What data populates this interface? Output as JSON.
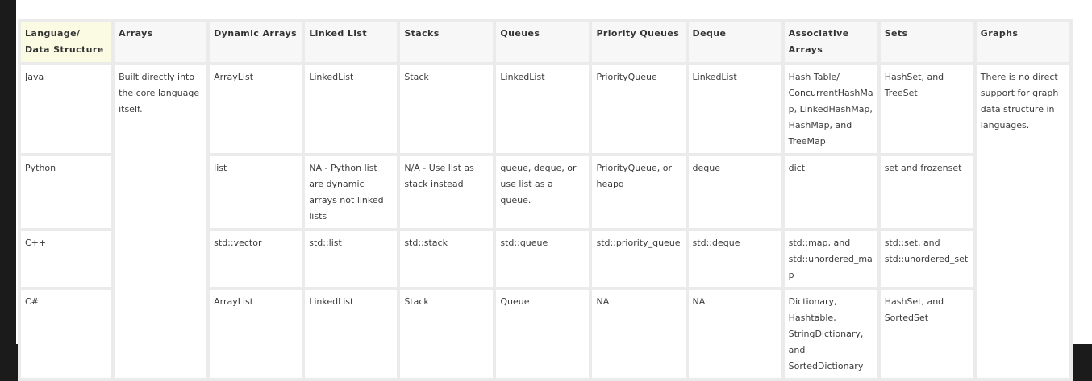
{
  "headers": [
    "Language/ Data Structure",
    "Arrays",
    "Dynamic Arrays",
    "Linked List",
    "Stacks",
    "Queues",
    "Priority Queues",
    "Deque",
    "Associative Arrays",
    "Sets",
    "Graphs"
  ],
  "arrays_note": "Built directly into the core language itself.",
  "graphs_note": "There is no direct support for graph data structure in languages.",
  "rows": [
    {
      "language": "Java",
      "dynamic_arrays": "ArrayList",
      "linked_list": "LinkedList",
      "stacks": "Stack",
      "queues": "LinkedList",
      "priority_queues": "PriorityQueue",
      "deque": "LinkedList",
      "associative_arrays": "Hash Table/ ConcurrentHashMap, LinkedHashMap, HashMap, and TreeMap",
      "sets": "HashSet, and TreeSet"
    },
    {
      "language": "Python",
      "dynamic_arrays": "list",
      "linked_list": "NA - Python list are dynamic arrays not linked lists",
      "stacks": "N/A - Use list as stack instead",
      "queues": "queue, deque, or use list as a queue.",
      "priority_queues": "PriorityQueue, or heapq",
      "deque": "deque",
      "associative_arrays": "dict",
      "sets": "set and frozenset"
    },
    {
      "language": "C++",
      "dynamic_arrays": "std::vector",
      "linked_list": "std::list",
      "stacks": "std::stack",
      "queues": "std::queue",
      "priority_queues": "std::priority_queue",
      "deque": "std::deque",
      "associative_arrays": "std::map, and std::unordered_map",
      "sets": "std::set, and std::unordered_set"
    },
    {
      "language": "C#",
      "dynamic_arrays": "ArrayList",
      "linked_list": "LinkedList",
      "stacks": "Stack",
      "queues": "Queue",
      "priority_queues": "NA",
      "deque": "NA",
      "associative_arrays": "Dictionary, Hashtable, StringDictionary, and SortedDictionary",
      "sets": "HashSet, and SortedSet"
    }
  ]
}
